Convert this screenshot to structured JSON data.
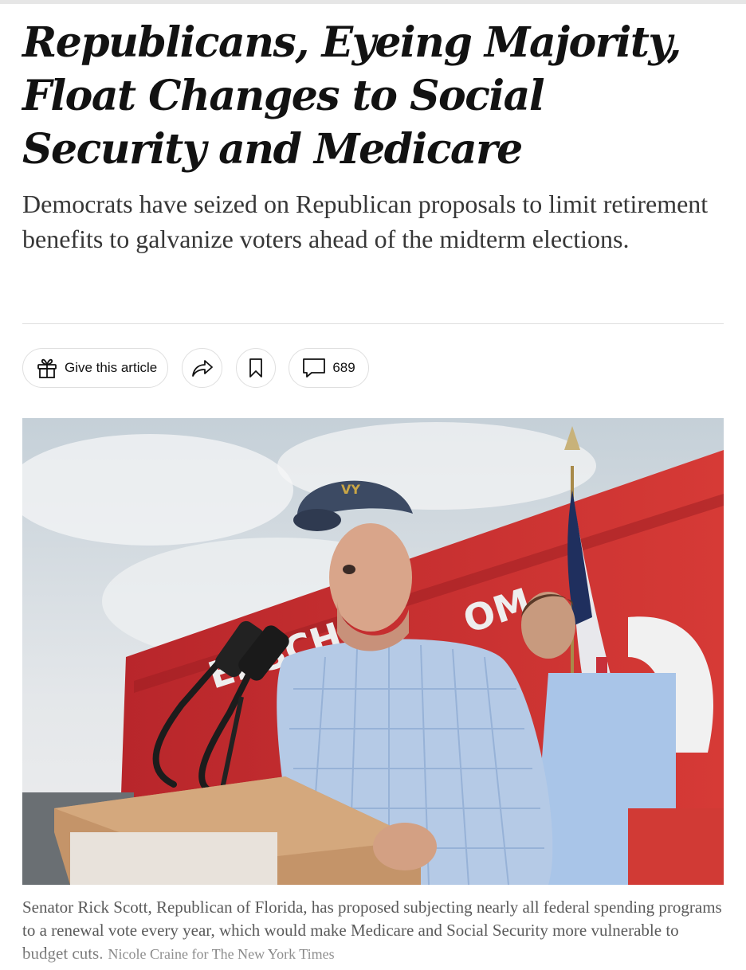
{
  "article": {
    "headline": "Republicans, Eyeing Majority, Float Changes to Social Security and Medicare",
    "summary": "Democrats have seized on Republican proposals to limit retirement benefits to galvanize voters ahead of the midterm elections."
  },
  "toolbar": {
    "gift_label": "Give this article",
    "comment_count": "689",
    "icons": [
      "gift-icon",
      "share-icon",
      "bookmark-icon",
      "comment-icon"
    ]
  },
  "photo": {
    "caption": "Senator Rick Scott, Republican of Florida, has proposed subjecting nearly all federal spending programs to a renewal vote every year, which would make Medicare and Social Security more vulnerable to budget cuts.",
    "credit": "Nicole Craine for The New York Times",
    "cap_letters": "VY",
    "bus_text": "ERSCH",
    "bus_text_2": "OM"
  },
  "colors": {
    "text": "#121212",
    "summary": "#363636",
    "caption": "#5a5a5a",
    "border": "#dfdfdf"
  }
}
